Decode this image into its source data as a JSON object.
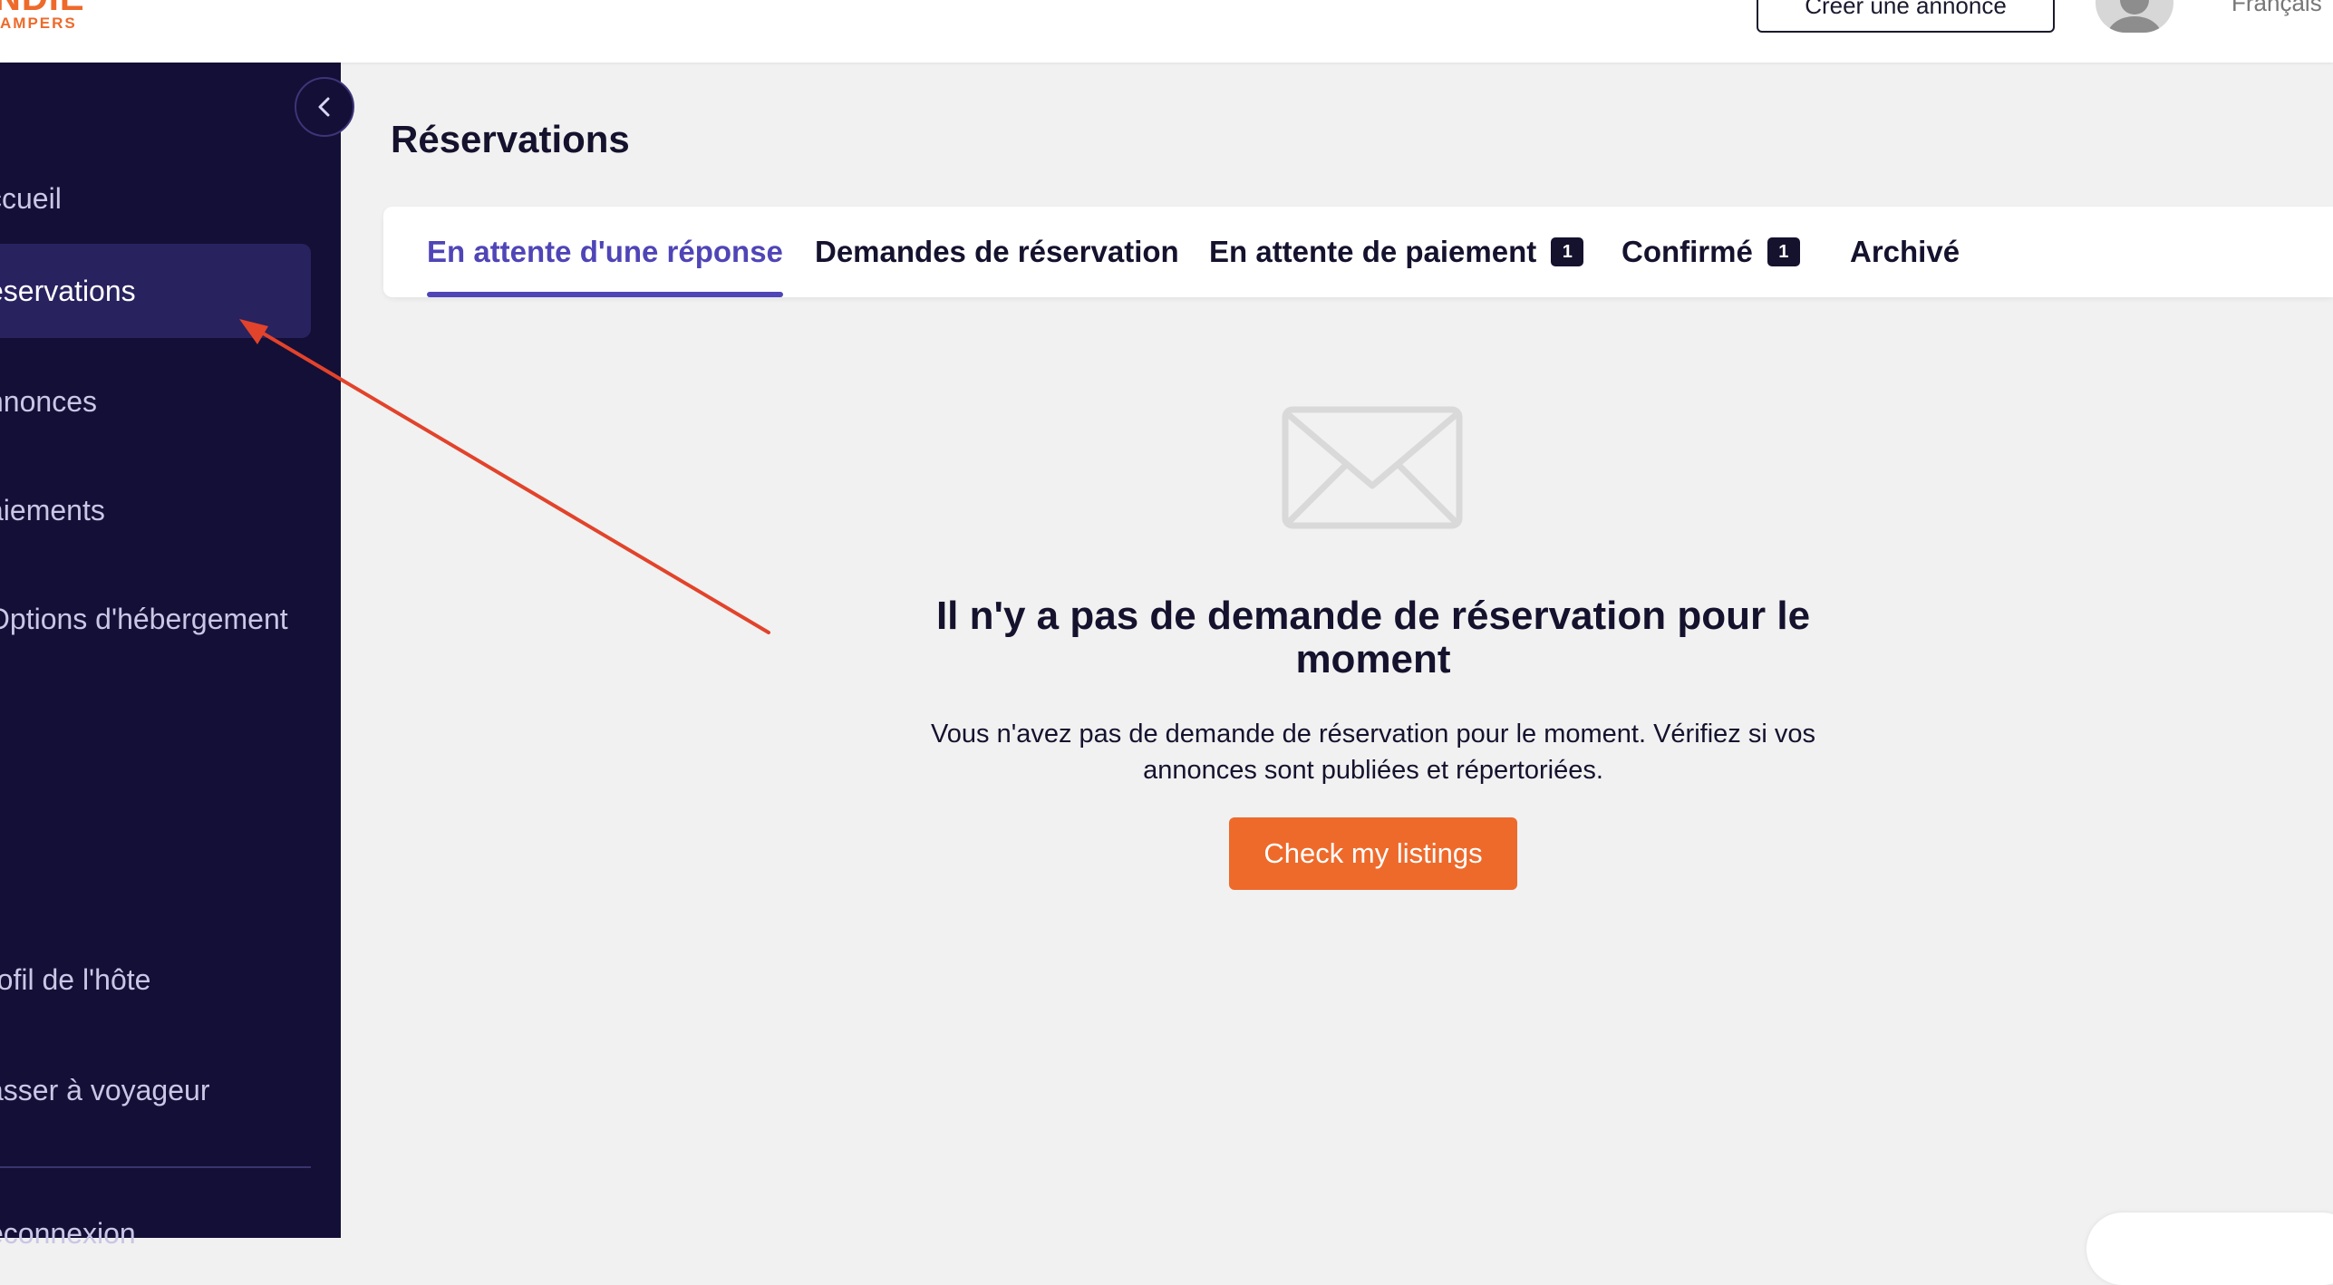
{
  "header": {
    "logo_text": "NDIE",
    "logo_sub": "AMPERS",
    "create_listing_label": "Créer une annonce",
    "language_label": "Français"
  },
  "sidebar": {
    "items": [
      {
        "label": "ccueil"
      },
      {
        "label": "éservations",
        "active": true
      },
      {
        "label": "nnonces"
      },
      {
        "label": "aiements"
      },
      {
        "label": "Options d'hébergement"
      },
      {
        "label": "rofil de l'hôte"
      },
      {
        "label": "asser à voyageur"
      },
      {
        "label": "éconnexion"
      }
    ]
  },
  "main": {
    "title": "Réservations",
    "tabs": [
      {
        "label": "En attente d'une réponse",
        "active": true
      },
      {
        "label": "Demandes de réservation"
      },
      {
        "label": "En attente de paiement",
        "badge": "1"
      },
      {
        "label": "Confirmé",
        "badge": "1"
      },
      {
        "label": "Archivé"
      }
    ],
    "empty_state": {
      "icon": "envelope-icon",
      "title": "Il n'y a pas de demande de réservation pour le moment",
      "description": "Vous n'avez pas de demande de réservation pour le moment. Vérifiez si vos annonces sont publiées et répertoriées.",
      "cta_label": "Check my listings"
    }
  },
  "colors": {
    "brand_orange": "#ee6a2b",
    "sidebar_bg": "#140f36",
    "active_tab": "#4f45b7",
    "annotation_arrow": "#e2432b"
  }
}
